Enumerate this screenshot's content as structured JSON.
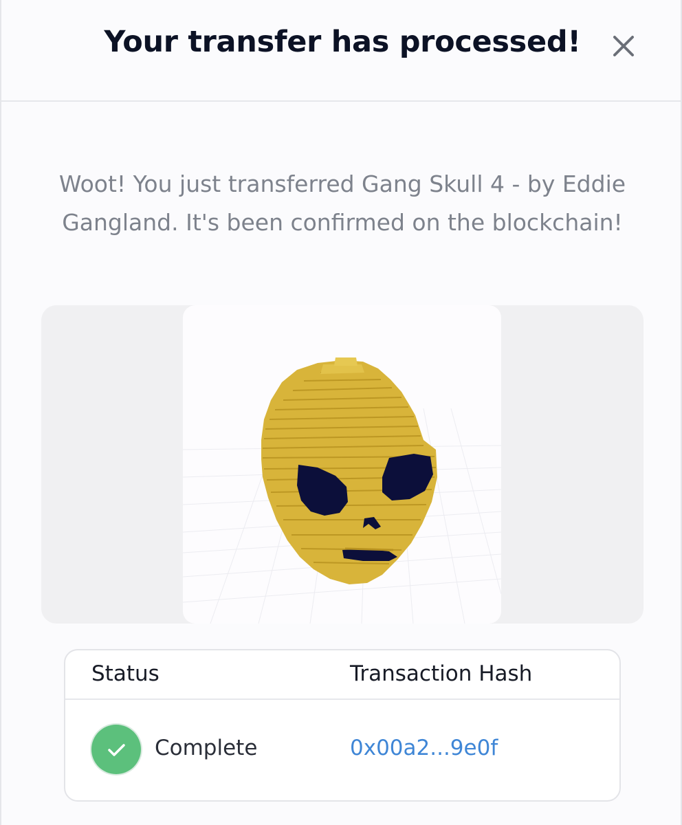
{
  "modal": {
    "title": "Your transfer has processed!",
    "close_icon": "close-icon",
    "message": "Woot! You just transferred Gang Skull 4 - by Eddie Gangland. It's been confirmed on the blockchain!"
  },
  "media": {
    "subject": "voxel-gold-skull-image"
  },
  "transaction_table": {
    "columns": [
      "Status",
      "Transaction Hash"
    ],
    "row": {
      "status": "Complete",
      "status_icon": "check-circle-icon",
      "hash": "0x00a2...9e0f"
    }
  },
  "colors": {
    "title": "#0c1225",
    "message": "#7d828c",
    "success": "#5cc07c",
    "link": "#3f86d6",
    "skull_gold": "#d8b43a",
    "skull_eyes": "#0c0f3a"
  }
}
